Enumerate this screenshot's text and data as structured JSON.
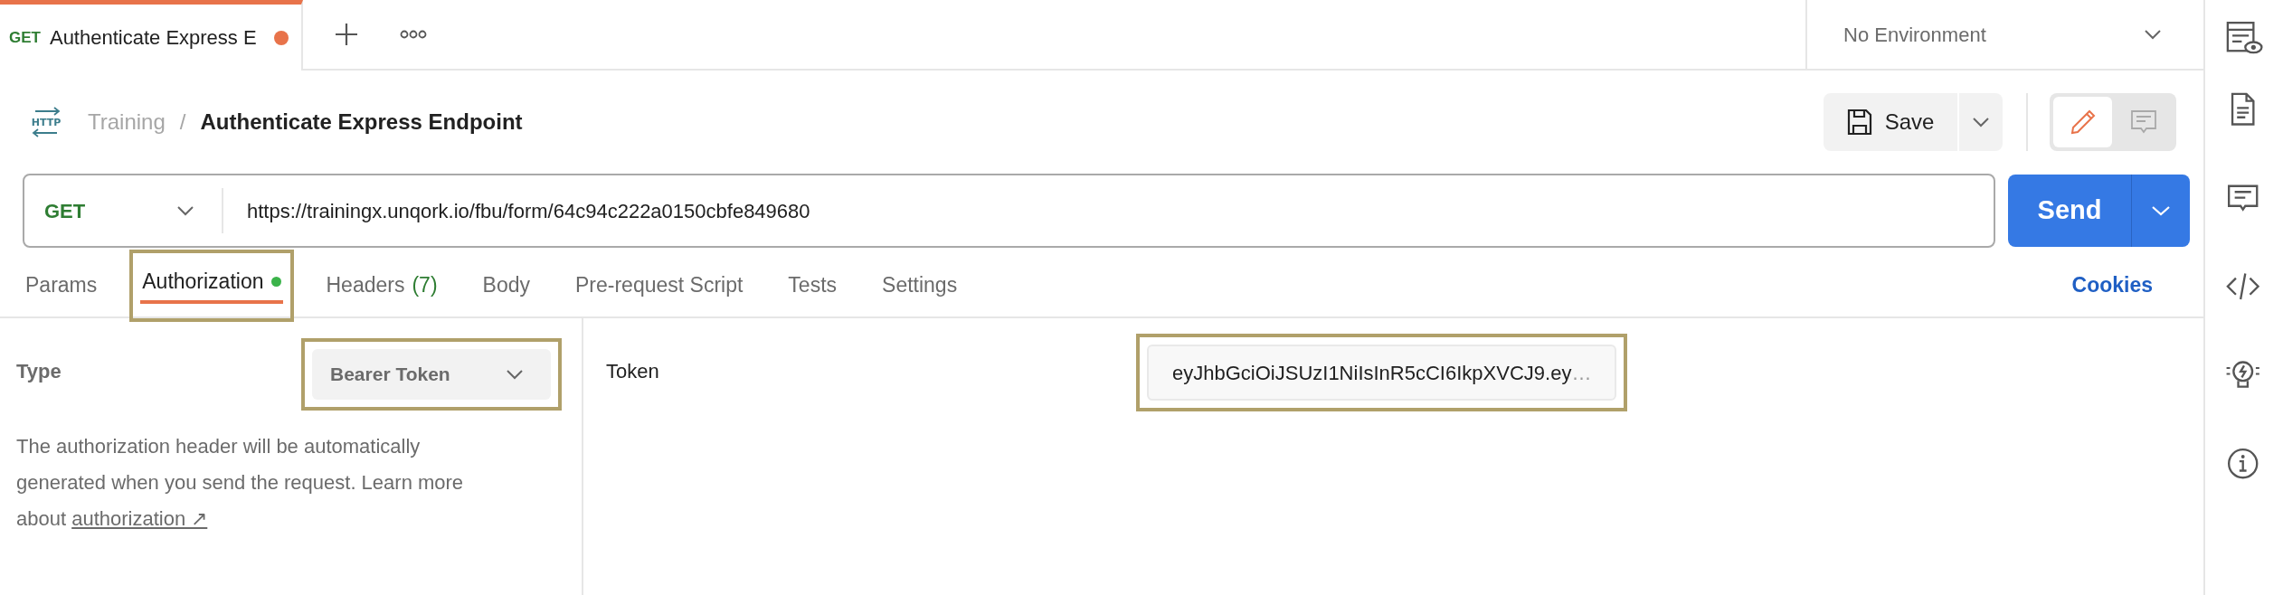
{
  "request_tabs": [
    {
      "method": "GET",
      "label": "Authenticate Express E",
      "selected": true,
      "unsaved": true
    }
  ],
  "environment": {
    "label": "No Environment"
  },
  "breadcrumb": {
    "protocol_icon": "HTTP",
    "collection": "Training",
    "separator": "/",
    "request": "Authenticate Express Endpoint"
  },
  "save_button": {
    "label": "Save"
  },
  "mode_toggle": [
    {
      "kind": "edit",
      "selected": true
    },
    {
      "kind": "comment",
      "selected": false
    }
  ],
  "url_bar": {
    "method": "GET",
    "url": "https://trainingx.unqork.io/fbu/form/64c94c222a0150cbfe849680"
  },
  "send_button": {
    "label": "Send"
  },
  "tabs": [
    {
      "label": "Params",
      "selected": false
    },
    {
      "label": "Authorization",
      "selected": true,
      "status_dot": true,
      "highlighted": true
    },
    {
      "label": "Headers",
      "count": "(7)",
      "selected": false
    },
    {
      "label": "Body",
      "selected": false
    },
    {
      "label": "Pre-request Script",
      "selected": false
    },
    {
      "label": "Tests",
      "selected": false
    },
    {
      "label": "Settings",
      "selected": false
    }
  ],
  "cookies_link": "Cookies",
  "auth": {
    "type_label": "Type",
    "type_value": "Bearer Token",
    "type_highlighted": true,
    "description": "The authorization header will be automatically generated when you send the request. Learn more about",
    "link": "authorization",
    "link_arrow": "↗",
    "token_label": "Token",
    "token_value": "eyJhbGciOiJSUzI1NiIsInR5cCI6IkpXVCJ9.ey",
    "token_overflow": "…",
    "token_highlighted": true
  },
  "right_sidebar": [
    {
      "kind": "docs"
    },
    {
      "kind": "comments"
    },
    {
      "kind": "code"
    },
    {
      "kind": "bulb"
    },
    {
      "kind": "info"
    }
  ]
}
